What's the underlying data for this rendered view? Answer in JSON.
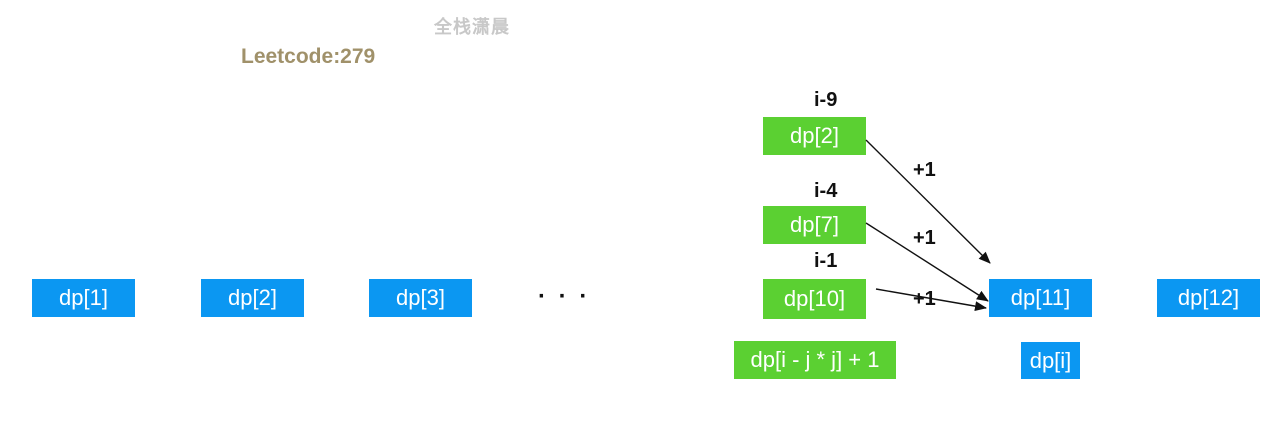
{
  "watermark": "全栈潇晨",
  "title": "Leetcode:279",
  "row": [
    {
      "label": "dp[1]"
    },
    {
      "label": "dp[2]"
    },
    {
      "label": "dp[3]"
    },
    {
      "label": "dp[11]"
    },
    {
      "label": "dp[12]"
    }
  ],
  "ellipsis": "· · ·",
  "predecessors": [
    {
      "offset": "i-9",
      "label": "dp[2]",
      "edge": "+1"
    },
    {
      "offset": "i-4",
      "label": "dp[7]",
      "edge": "+1"
    },
    {
      "offset": "i-1",
      "label": "dp[10]",
      "edge": "+1"
    }
  ],
  "formula": "dp[i - j * j] + 1",
  "target": "dp[i]",
  "colors": {
    "blue": "#0b97f2",
    "green": "#5bd032",
    "title": "#a0916a",
    "watermark": "#c8c8c8"
  }
}
